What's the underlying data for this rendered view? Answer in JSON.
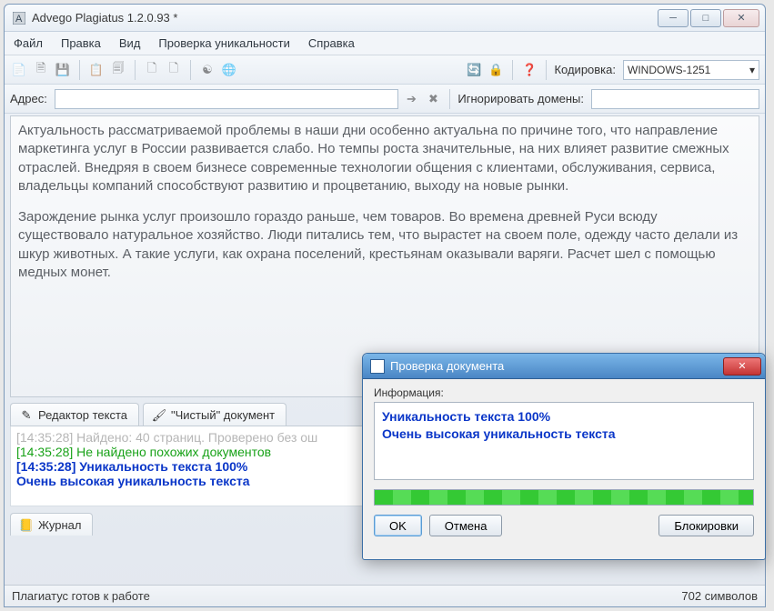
{
  "title": "Advego Plagiatus 1.2.0.93 *",
  "menu": {
    "file": "Файл",
    "edit": "Правка",
    "view": "Вид",
    "check": "Проверка уникальности",
    "help": "Справка"
  },
  "toolbar": {
    "encoding_label": "Кодировка:",
    "encoding_value": "WINDOWS-1251",
    "address_label": "Адрес:",
    "ignore_label": "Игнорировать домены:"
  },
  "text": {
    "p1": "Актуальность рассматриваемой проблемы в наши дни особенно актуальна по причине того, что направление маркетинга услуг в России развивается слабо. Но темпы роста значительные, на них влияет развитие смежных отраслей. Внедряя в своем бизнесе современные технологии общения с клиентами, обслуживания, сервиса, владельцы компаний способствуют развитию и процветанию, выходу на новые рынки.",
    "p2": "Зарождение рынка услуг произошло гораздо раньше, чем товаров. Во времена древней Руси всюду существовало натуральное хозяйство. Люди питались тем, что вырастет на своем поле, одежду часто делали из шкур животных. А такие услуги, как охрана поселений, крестьянам оказывали варяги. Расчет шел с помощью медных монет."
  },
  "tabs": {
    "editor": "Редактор текста",
    "clean": "\"Чистый\" документ"
  },
  "log": {
    "l0": "[14:35:28] Найдено: 40 страниц. Проверено без ош",
    "l1": "[14:35:28] Не найдено похожих документов",
    "l2": "[14:35:28] Уникальность текста 100%",
    "l3": "Очень высокая уникальность текста"
  },
  "journal_tab": "Журнал",
  "status": {
    "left": "Плагиатус готов к работе",
    "right": "702 символов"
  },
  "dialog": {
    "title": "Проверка документа",
    "info_label": "Информация:",
    "info_line1": "Уникальность текста 100%",
    "info_line2": "Очень высокая уникальность текста",
    "ok": "OK",
    "cancel": "Отмена",
    "locks": "Блокировки"
  }
}
